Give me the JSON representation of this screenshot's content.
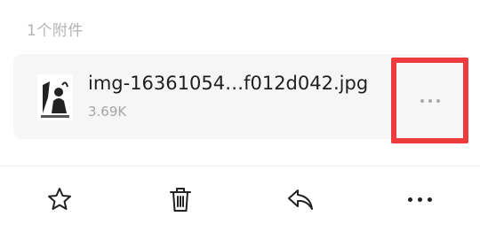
{
  "attachments": {
    "count_label": "1个附件",
    "items": [
      {
        "name": "img-16361054…f012d042.jpg",
        "size": "3.69K",
        "thumbnail_icon": "image-thumbnail-icon"
      }
    ]
  },
  "highlight_color": "#ee3b3d",
  "toolbar": {
    "icons": [
      "star-icon",
      "trash-icon",
      "reply-icon",
      "more-icon"
    ]
  }
}
